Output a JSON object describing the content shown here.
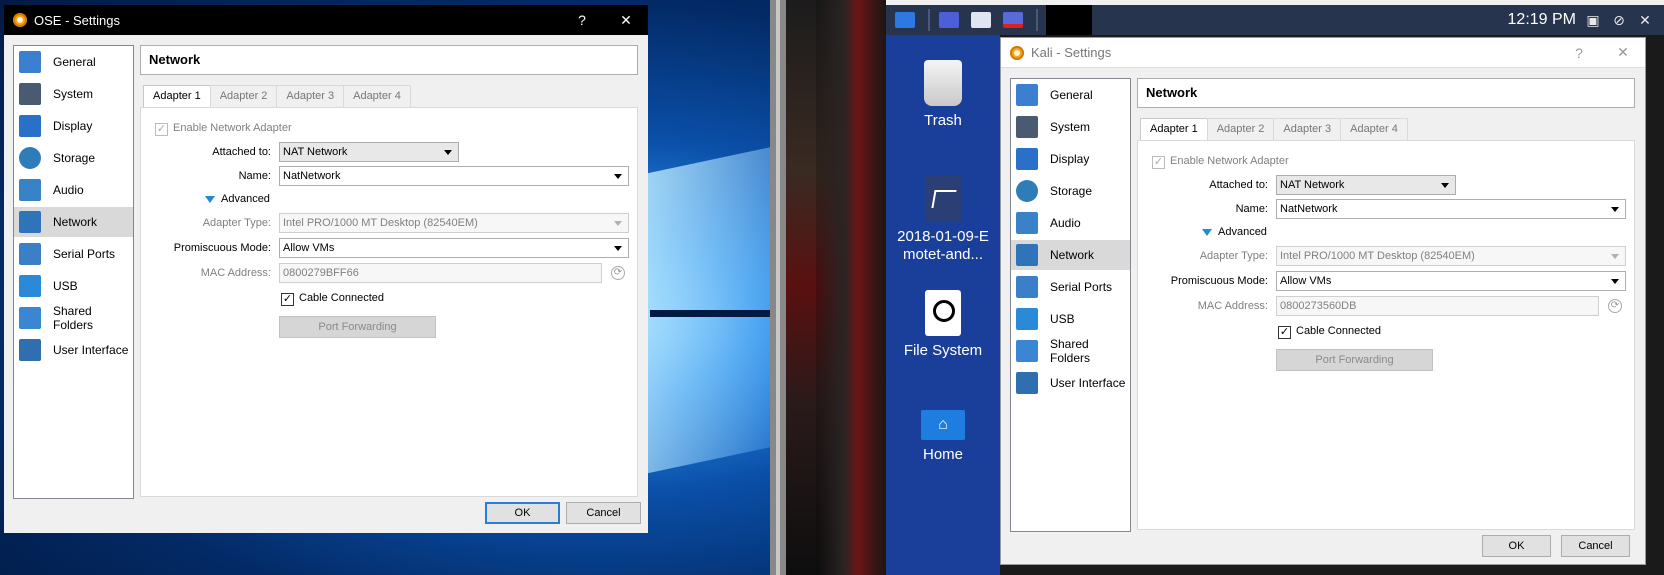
{
  "left_dialog": {
    "title": "OSE - Settings",
    "help_btn": "?",
    "close_btn": "✕",
    "section_title": "Network",
    "mac": "0800279BFF66"
  },
  "right_dialog": {
    "title": "Kali - Settings",
    "help_btn": "?",
    "close_btn": "✕",
    "section_title": "Network",
    "mac": "0800273560DB"
  },
  "sidebar_items": [
    {
      "label": "General",
      "icon": "general-icon",
      "color": "#3b7fd1"
    },
    {
      "label": "System",
      "icon": "system-icon",
      "color": "#4a5a70"
    },
    {
      "label": "Display",
      "icon": "display-icon",
      "color": "#2a6fc8"
    },
    {
      "label": "Storage",
      "icon": "storage-icon",
      "color": "#2f7db8"
    },
    {
      "label": "Audio",
      "icon": "audio-icon",
      "color": "#3a82c8"
    },
    {
      "label": "Network",
      "icon": "network-icon",
      "color": "#2f74b8"
    },
    {
      "label": "Serial Ports",
      "icon": "serial-ports-icon",
      "color": "#3a7fc8"
    },
    {
      "label": "USB",
      "icon": "usb-icon",
      "color": "#2a8ad8"
    },
    {
      "label": "Shared Folders",
      "icon": "shared-folders-icon",
      "color": "#3a86d2"
    },
    {
      "label": "User Interface",
      "icon": "user-interface-icon",
      "color": "#2f6fb0"
    }
  ],
  "tabs": [
    "Adapter 1",
    "Adapter 2",
    "Adapter 3",
    "Adapter 4"
  ],
  "form": {
    "enable_adapter": "Enable Network Adapter",
    "attached_to_label": "Attached to:",
    "attached_to_value": "NAT Network",
    "name_label": "Name:",
    "name_value": "NatNetwork",
    "advanced": "Advanced",
    "adapter_type_label": "Adapter Type:",
    "adapter_type_value": "Intel PRO/1000 MT Desktop (82540EM)",
    "promiscuous_label": "Promiscuous Mode:",
    "promiscuous_value": "Allow VMs",
    "mac_label": "MAC Address:",
    "cable_connected": "Cable Connected",
    "port_forwarding": "Port Forwarding"
  },
  "buttons": {
    "ok": "OK",
    "cancel": "Cancel"
  },
  "kali_panel": {
    "clock": "12:19 PM"
  },
  "desktop_icons": [
    {
      "label": "Trash",
      "icon": "trash-icon"
    },
    {
      "label": "2018-01-09-Emotet-and...",
      "icon": "file-icon"
    },
    {
      "label": "File System",
      "icon": "drive-icon"
    },
    {
      "label": "Home",
      "icon": "home-icon"
    }
  ]
}
